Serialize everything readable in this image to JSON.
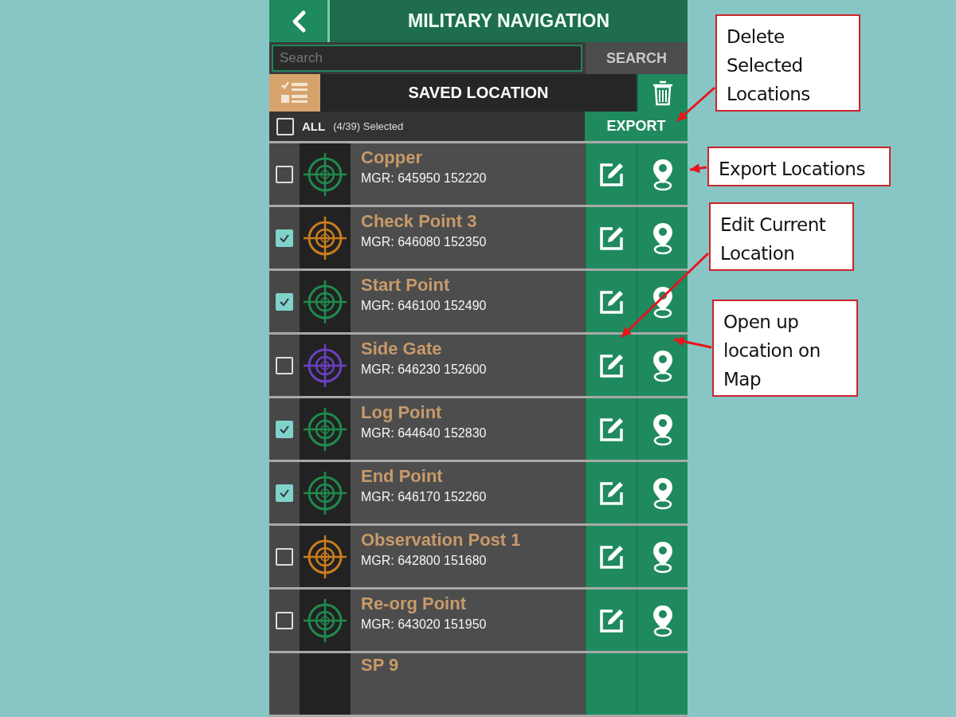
{
  "header": {
    "title": "MILITARY NAVIGATION"
  },
  "search": {
    "placeholder": "Search",
    "button": "SEARCH"
  },
  "saved_bar": {
    "title": "SAVED LOCATION"
  },
  "select_bar": {
    "all_label": "ALL",
    "all_checked": false,
    "count": "(4/39) Selected",
    "export": "EXPORT"
  },
  "locations": [
    {
      "kind": "full",
      "name": "Copper",
      "mgr": "MGR: 645950 152220",
      "checked": false,
      "color": "#1f8a4c"
    },
    {
      "kind": "full",
      "name": "Check Point 3",
      "mgr": "MGR: 646080 152350",
      "checked": true,
      "color": "#c97d1e"
    },
    {
      "kind": "full",
      "name": "Start Point",
      "mgr": "MGR: 646100 152490",
      "checked": true,
      "color": "#1f8a4c"
    },
    {
      "kind": "full",
      "name": "Side Gate",
      "mgr": "MGR: 646230 152600",
      "checked": false,
      "color": "#6b3fc0"
    },
    {
      "kind": "full",
      "name": "Log Point",
      "mgr": "MGR: 644640 152830",
      "checked": true,
      "color": "#1f8a4c"
    },
    {
      "kind": "full",
      "name": "End Point",
      "mgr": "MGR: 646170 152260",
      "checked": true,
      "color": "#1f8a4c"
    },
    {
      "kind": "full",
      "name": "Observation Post 1",
      "mgr": "MGR: 642800 151680",
      "checked": false,
      "color": "#c97d1e"
    },
    {
      "kind": "full",
      "name": "Re-org Point",
      "mgr": "MGR: 643020 151950",
      "checked": false,
      "color": "#1f8a4c"
    },
    {
      "kind": "partial",
      "name": "SP 9"
    }
  ],
  "callouts": [
    {
      "text": "Delete Selected Locations"
    },
    {
      "text": "Export Locations"
    },
    {
      "text": "Edit Current Location"
    },
    {
      "text": "Open up location on Map"
    }
  ]
}
